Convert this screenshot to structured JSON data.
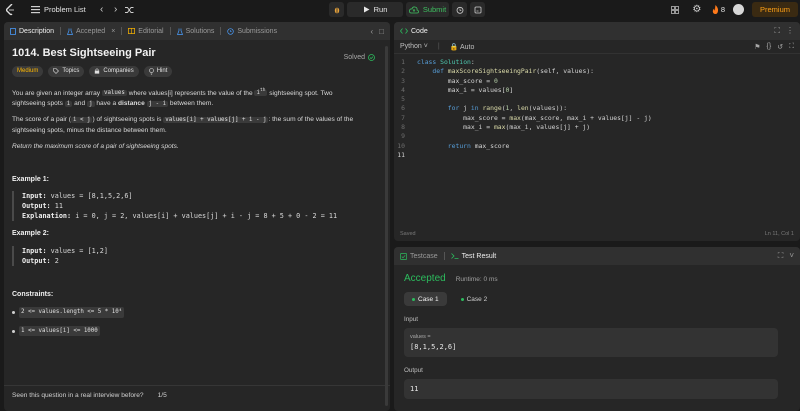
{
  "topbar": {
    "problem_list": "Problem List",
    "run": "Run",
    "submit": "Submit",
    "streak": "8",
    "premium": "Premium"
  },
  "desc_tabs": {
    "description": "Description",
    "accepted": "Accepted",
    "editorial": "Editorial",
    "solutions": "Solutions",
    "submissions": "Submissions"
  },
  "problem": {
    "title": "1014. Best Sightseeing Pair",
    "status": "Solved",
    "tags": {
      "difficulty": "Medium",
      "topics": "Topics",
      "companies": "Companies",
      "hint": "Hint"
    },
    "p1": {
      "a": "You are given an integer array",
      "code_values": "values",
      "b": "where values[i] represents the value of the",
      "code_ith": "i",
      "sup_th": "th",
      "c": "sightseeing spot. Two",
      "d": "sightseeing spots",
      "code_i": "i",
      "and": "and",
      "code_j": "j",
      "e": "have a",
      "distance": "distance",
      "code_jmi": "j - i",
      "f": "between them."
    },
    "p2": {
      "a": "The score of a pair (",
      "code_ilj": "i < j",
      "b": ") of sightseeing spots is",
      "code_formula": "values[i] + values[j] + i - j",
      "c": ": the sum of the values of the",
      "d": "sightseeing spots, minus the distance between them."
    },
    "p3": "Return the maximum score of a pair of sightseeing spots.",
    "example1": {
      "title": "Example 1:",
      "input_label": "Input:",
      "input": "values = [8,1,5,2,6]",
      "output_label": "Output:",
      "output": "11",
      "expl_label": "Explanation:",
      "expl": "i = 0, j = 2, values[i] + values[j] + i - j = 8 + 5 + 0 - 2 = 11"
    },
    "example2": {
      "title": "Example 2:",
      "input_label": "Input:",
      "input": "values = [1,2]",
      "output_label": "Output:",
      "output": "2"
    },
    "constraints_title": "Constraints:",
    "constraints": [
      "2 <= values.length <= 5 * 10⁴",
      "1 <= values[i] <= 1000"
    ],
    "feedback_q": "Seen this question in a real interview before?",
    "feedback_count": "1/5"
  },
  "code_panel": {
    "tab": "Code",
    "language": "Python",
    "auto": "Auto",
    "lines": [
      "class Solution:",
      "    def maxScoreSightseeingPair(self, values):",
      "        max_score = 0",
      "        max_i = values[0]",
      "",
      "        for j in range(1, len(values)):",
      "            max_score = max(max_score, max_i + values[j] - j)",
      "            max_i = max(max_i, values[j] + j)",
      "",
      "        return max_score",
      ""
    ],
    "line_numbers": [
      "1",
      "2",
      "3",
      "4",
      "5",
      "6",
      "7",
      "8",
      "9",
      "10",
      "11"
    ],
    "saved": "Saved",
    "cursor": "Ln 11, Col 1"
  },
  "test_panel": {
    "tab_testcase": "Testcase",
    "tab_result": "Test Result",
    "status": "Accepted",
    "runtime": "Runtime: 0 ms",
    "case1": "Case 1",
    "case2": "Case 2",
    "input_label": "Input",
    "var_name": "values =",
    "var_value": "[8,1,5,2,6]",
    "output_label": "Output",
    "output_value": "11"
  },
  "colors": {
    "accent_green": "#2cbb5d",
    "premium_orange": "#ffa116",
    "medium_yellow": "#ffb800"
  }
}
